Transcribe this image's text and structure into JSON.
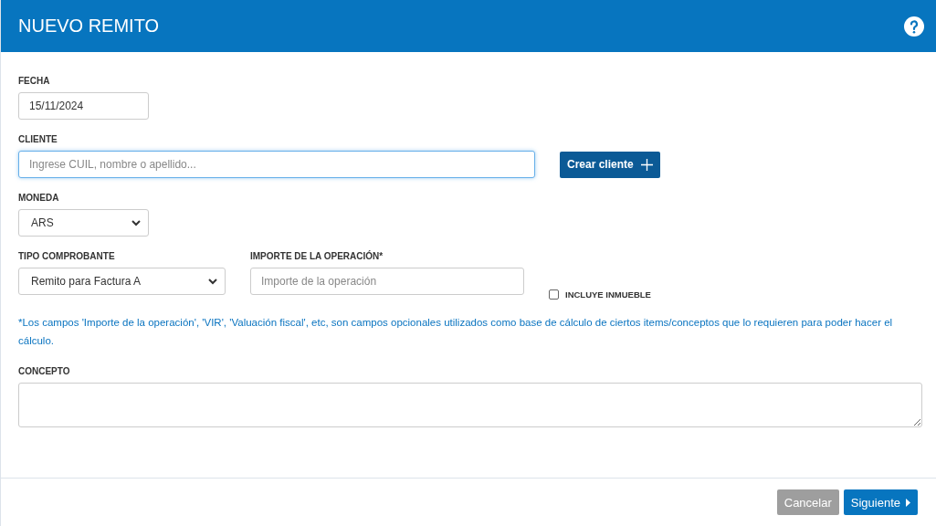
{
  "header": {
    "title": "NUEVO REMITO"
  },
  "fecha": {
    "label": "FECHA",
    "value": "15/11/2024"
  },
  "cliente": {
    "label": "CLIENTE",
    "placeholder": "Ingrese CUIL, nombre o apellido...",
    "focused": true,
    "button": "Crear cliente"
  },
  "moneda": {
    "label": "MONEDA",
    "value": "ARS"
  },
  "tipo_comprobante": {
    "label": "TIPO COMPROBANTE",
    "value": "Remito para Factura A"
  },
  "importe": {
    "label": "IMPORTE DE LA OPERACIÓN*",
    "placeholder": "Importe de la operación"
  },
  "incluye_inmueble": {
    "label": "INCLUYE INMUEBLE",
    "checked": false
  },
  "note": "*Los campos 'Importe de la operación', 'VIR', 'Valuación fiscal', etc, son campos opcionales utilizados como base de cálculo de ciertos items/conceptos que lo requieren para poder hacer el cálculo.",
  "concepto": {
    "label": "CONCEPTO"
  },
  "footer": {
    "buttons": [
      {
        "label": "Cancelar",
        "kind": "secondary"
      },
      {
        "label": "Siguiente",
        "kind": "primary"
      }
    ]
  }
}
